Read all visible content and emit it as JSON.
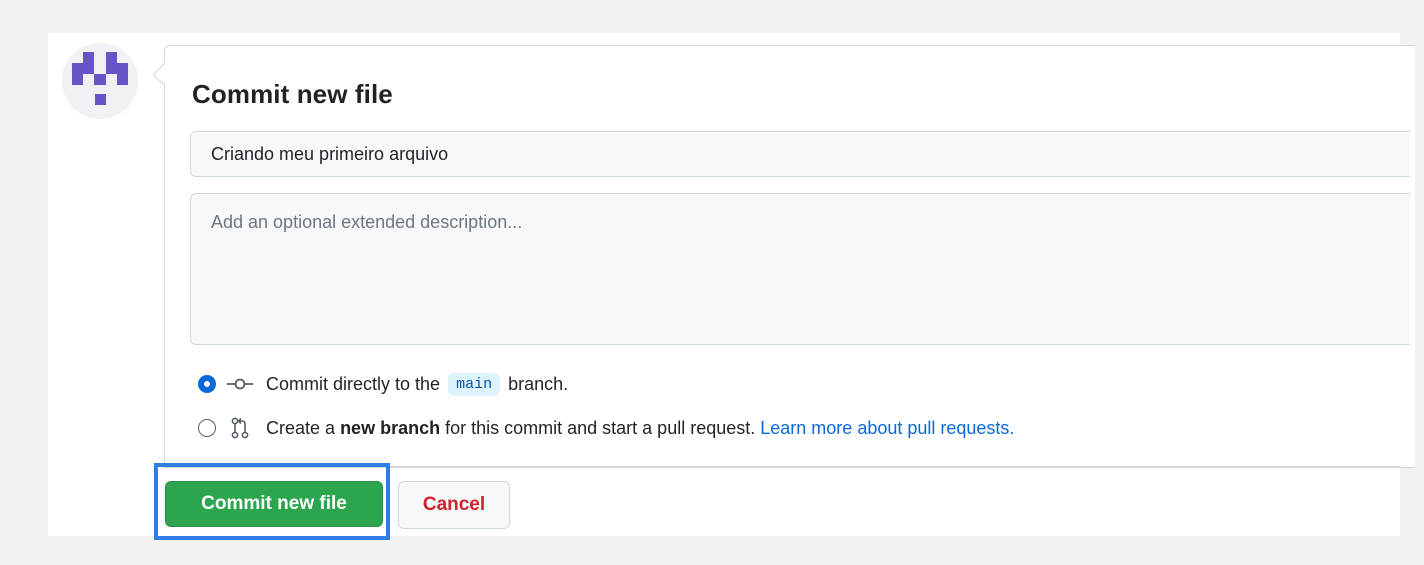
{
  "form": {
    "title": "Commit new file",
    "summary_value": "Criando meu primeiro arquivo",
    "description_placeholder": "Add an optional extended description...",
    "option_direct": {
      "prefix": "Commit directly to the",
      "branch": "main",
      "suffix": "branch.",
      "checked": true
    },
    "option_new_branch": {
      "prefix": "Create a",
      "emphasis": "new branch",
      "suffix": "for this commit and start a pull request.",
      "link": "Learn more about pull requests.",
      "checked": false
    },
    "commit_button": "Commit new file",
    "cancel_button": "Cancel"
  },
  "icons": {
    "avatar": "identicon-avatar",
    "commit": "git-commit-icon",
    "pull_request": "git-pull-request-icon"
  },
  "colors": {
    "primary_green": "#2da44e",
    "accent_blue": "#0969da",
    "danger_red": "#cf222e",
    "highlight_blue": "#2f7ee8"
  }
}
